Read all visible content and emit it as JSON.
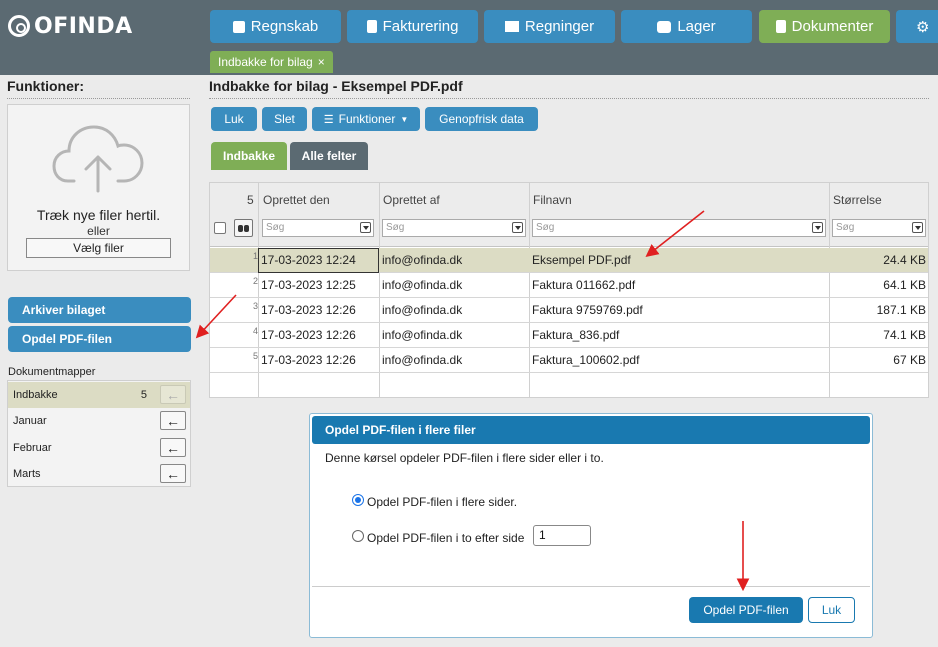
{
  "app": {
    "logo": "OFINDA"
  },
  "nav": {
    "items": [
      {
        "label": "Regnskab",
        "icon": "calendar-icon"
      },
      {
        "label": "Fakturering",
        "icon": "clipboard-icon"
      },
      {
        "label": "Regninger",
        "icon": "factory-icon"
      },
      {
        "label": "Lager",
        "icon": "cubes-icon"
      },
      {
        "label": "Dokumenter",
        "icon": "file-icon",
        "active": true
      },
      {
        "label": "",
        "icon": "gear-icon"
      }
    ],
    "open_tab": {
      "label": "Indbakke for bilag",
      "close": "×"
    }
  },
  "sidebar": {
    "title": "Funktioner:",
    "upload": {
      "drag_text": "Træk nye filer hertil.",
      "or_text": "eller",
      "choose_label": "Vælg filer"
    },
    "buttons": {
      "archive": "Arkiver bilaget",
      "split": "Opdel PDF-filen"
    },
    "folders_title": "Dokumentmapper",
    "folders": [
      {
        "name": "Indbakke",
        "count": "5",
        "selected": true
      },
      {
        "name": "Januar",
        "count": ""
      },
      {
        "name": "Februar",
        "count": ""
      },
      {
        "name": "Marts",
        "count": ""
      }
    ],
    "arrow_glyph": "←"
  },
  "main": {
    "title": "Indbakke for bilag - Eksempel PDF.pdf",
    "toolbar": {
      "close": "Luk",
      "delete": "Slet",
      "functions": "Funktioner",
      "refresh": "Genopfrisk data"
    },
    "tabs": {
      "inbox": "Indbakke",
      "all_fields": "Alle felter"
    }
  },
  "grid": {
    "row_count": "5",
    "headers": {
      "created": "Oprettet den",
      "created_by": "Oprettet af",
      "filename": "Filnavn",
      "size": "Størrelse"
    },
    "filter_placeholder": "Søg",
    "rows": [
      {
        "n": "1",
        "created": "17-03-2023 12:24",
        "by": "info@ofinda.dk",
        "file": "Eksempel PDF.pdf",
        "size": "24.4 KB",
        "selected": true
      },
      {
        "n": "2",
        "created": "17-03-2023 12:25",
        "by": "info@ofinda.dk",
        "file": "Faktura 011662.pdf",
        "size": "64.1 KB"
      },
      {
        "n": "3",
        "created": "17-03-2023 12:26",
        "by": "info@ofinda.dk",
        "file": "Faktura 9759769.pdf",
        "size": "187.1 KB"
      },
      {
        "n": "4",
        "created": "17-03-2023 12:26",
        "by": "info@ofinda.dk",
        "file": "Faktura_836.pdf",
        "size": "74.1 KB"
      },
      {
        "n": "5",
        "created": "17-03-2023 12:26",
        "by": "info@ofinda.dk",
        "file": "Faktura_100602.pdf",
        "size": "67 KB"
      }
    ]
  },
  "dialog": {
    "title": "Opdel PDF-filen i flere filer",
    "description": "Denne kørsel opdeler PDF-filen i flere sider eller i to.",
    "option_pages": "Opdel PDF-filen i flere sider.",
    "option_two": "Opdel PDF-filen i to efter side",
    "page_value": "1",
    "ok": "Opdel PDF-filen",
    "close": "Luk"
  },
  "colors": {
    "topbar": "#5b6a72",
    "accent_blue": "#3a8dbf",
    "active_green": "#7fae56",
    "dialog_blue": "#1979b0",
    "arrow_red": "#e02020"
  }
}
